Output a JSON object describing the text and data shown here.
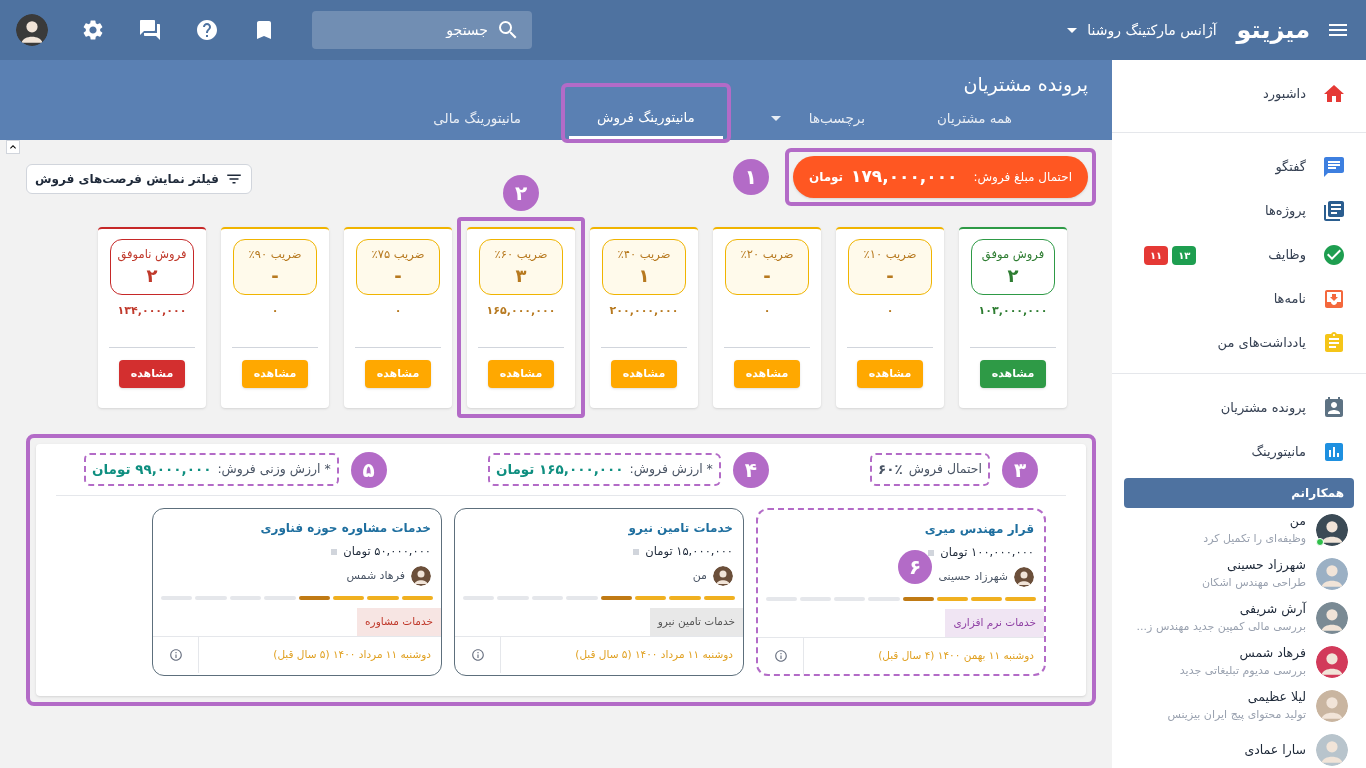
{
  "header": {
    "logo": "میزیتو",
    "organization": "آژانس مارکتینگ روشنا",
    "search": {
      "placeholder": "جستجو"
    }
  },
  "page": {
    "title": "پرونده مشتریان",
    "tabs": [
      {
        "label": "همه مشتریان",
        "selected": false,
        "dropdown": false,
        "annotated": false
      },
      {
        "label": "برچسب‌ها",
        "selected": false,
        "dropdown": true,
        "annotated": false
      },
      {
        "label": "مانیتورینگ فروش",
        "selected": true,
        "dropdown": false,
        "annotated": true
      },
      {
        "label": "مانیتورینگ مالی",
        "selected": false,
        "dropdown": false,
        "annotated": false
      }
    ]
  },
  "filter_button": "فیلتر نمایش فرصت‌های فروش",
  "sales_total": {
    "label": "احتمال مبلغ فروش:",
    "amount": "۱۷۹,۰۰۰,۰۰۰",
    "currency": "تومان",
    "annotation": "۱"
  },
  "stages": [
    {
      "kind": "won",
      "label": "فروش موفق",
      "count": "۲",
      "amount": "۱۰۳,۰۰۰,۰۰۰",
      "button": "مشاهده",
      "selected": false
    },
    {
      "kind": "open",
      "label": "ضریب ۱۰٪",
      "count": "-",
      "amount": "۰",
      "button": "مشاهده",
      "selected": false
    },
    {
      "kind": "open",
      "label": "ضریب ۲۰٪",
      "count": "-",
      "amount": "۰",
      "button": "مشاهده",
      "selected": false
    },
    {
      "kind": "open",
      "label": "ضریب ۴۰٪",
      "count": "۱",
      "amount": "۲۰۰,۰۰۰,۰۰۰",
      "button": "مشاهده",
      "selected": false
    },
    {
      "kind": "open",
      "label": "ضریب ۶۰٪",
      "count": "۳",
      "amount": "۱۶۵,۰۰۰,۰۰۰",
      "button": "مشاهده",
      "selected": true,
      "annotation": "۲"
    },
    {
      "kind": "open",
      "label": "ضریب ۷۵٪",
      "count": "-",
      "amount": "۰",
      "button": "مشاهده",
      "selected": false
    },
    {
      "kind": "open",
      "label": "ضریب ۹۰٪",
      "count": "-",
      "amount": "۰",
      "button": "مشاهده",
      "selected": false
    },
    {
      "kind": "lost",
      "label": "فروش ناموفق",
      "count": "۲",
      "amount": "۱۳۴,۰۰۰,۰۰۰",
      "button": "مشاهده",
      "selected": false
    }
  ],
  "detail": {
    "stats": [
      {
        "kind": "probability",
        "label": "احتمال فروش",
        "value": "۶۰٪",
        "annotation": "۳"
      },
      {
        "kind": "amount",
        "label": "* ارزش فروش:",
        "value": "۱۶۵,۰۰۰,۰۰۰ تومان",
        "annotation": "۴"
      },
      {
        "kind": "amount",
        "label": "* ارزش وزنی فروش:",
        "value": "۹۹,۰۰۰,۰۰۰ تومان",
        "annotation": "۵"
      }
    ],
    "deals": [
      {
        "title": "قرار مهندس میری",
        "amount": "۱۰۰,۰۰۰,۰۰۰ تومان",
        "owner": "شهرزاد حسینی",
        "level": 0.5,
        "tag": {
          "label": "خدمات نرم افزاری",
          "color": "#8e3fa3"
        },
        "date": "دوشنبه ۱۱ بهمن ۱۴۰۰ (۴ سال قبل)",
        "annotation": "۶"
      },
      {
        "title": "خدمات تامین نیرو",
        "amount": "۱۵,۰۰۰,۰۰۰ تومان",
        "owner": "من",
        "level": 0.5,
        "tag": {
          "label": "خدمات تامین نیرو",
          "color": "#555555"
        },
        "date": "دوشنبه ۱۱ مرداد ۱۴۰۰ (۵ سال قبل)"
      },
      {
        "title": "خدمات مشاوره حوزه فناوری",
        "amount": "۵۰,۰۰۰,۰۰۰ تومان",
        "owner": "فرهاد شمس",
        "level": 0.5,
        "tag": {
          "label": "خدمات مشاوره",
          "color": "#c0392b"
        },
        "date": "دوشنبه ۱۱ مرداد ۱۴۰۰ (۵ سال قبل)"
      }
    ]
  },
  "sidebar": {
    "nav_groups": [
      [
        {
          "kind": "home",
          "label": "داشبورد"
        }
      ],
      [
        {
          "kind": "chat",
          "label": "گفتگو"
        },
        {
          "kind": "projects",
          "label": "پروژه‌ها"
        },
        {
          "kind": "tasks",
          "label": "وظایف",
          "badges": [
            {
              "text": "۱۳",
              "color": "#1e9e50"
            },
            {
              "text": "۱۱",
              "color": "#e53935"
            }
          ]
        },
        {
          "kind": "mail",
          "label": "نامه‌ها"
        },
        {
          "kind": "notes",
          "label": "یادداشت‌های من"
        }
      ],
      [
        {
          "kind": "contacts",
          "label": "پرونده مشتریان"
        },
        {
          "kind": "chart",
          "label": "مانیتورینگ"
        }
      ]
    ],
    "colleagues": {
      "title": "همکارانم",
      "people": [
        {
          "name": "من",
          "status": "وظیفه‌ای را تکمیل کرد",
          "online": true
        },
        {
          "name": "شهرزاد حسینی",
          "status": "طراحی مهندس اشکان",
          "online": false
        },
        {
          "name": "آرش شریفی",
          "status": "بررسی مالی کمپین جدید مهندس ز...",
          "online": false
        },
        {
          "name": "فرهاد شمس",
          "status": "بررسی مدیوم تبلیغاتی جدید",
          "online": false
        },
        {
          "name": "لیلا عظیمی",
          "status": "تولید محتوای پیج ایران بیزینس",
          "online": false
        },
        {
          "name": "سارا عمادی",
          "online": false
        }
      ]
    }
  }
}
